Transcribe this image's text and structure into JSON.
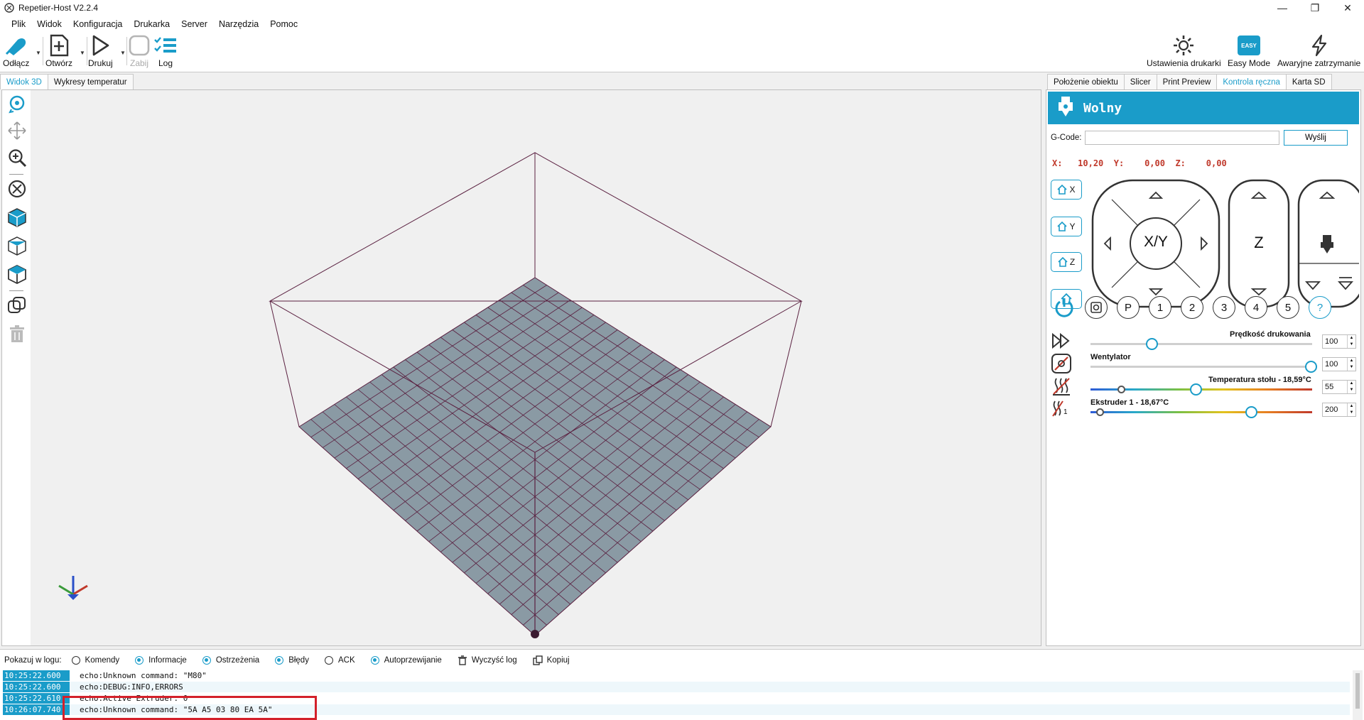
{
  "window": {
    "title": "Repetier-Host V2.2.4"
  },
  "menu": [
    "Plik",
    "Widok",
    "Konfiguracja",
    "Drukarka",
    "Server",
    "Narzędzia",
    "Pomoc"
  ],
  "toolbar": {
    "disconnect": "Odłącz",
    "open": "Otwórz",
    "print": "Drukuj",
    "kill": "Zabij",
    "log": "Log",
    "printer_settings": "Ustawienia drukarki",
    "easy_mode": "Easy Mode",
    "easy_badge": "EASY",
    "emergency_stop": "Awaryjne zatrzymanie"
  },
  "left_tabs": [
    "Widok 3D",
    "Wykresy temperatur"
  ],
  "right_tabs": [
    "Położenie obiektu",
    "Slicer",
    "Print Preview",
    "Kontrola ręczna",
    "Karta SD"
  ],
  "manual_control": {
    "status": "Wolny",
    "gcode_label": "G-Code:",
    "gcode_value": "",
    "send_label": "Wyślij",
    "coords": {
      "x_label": "X:",
      "x": "10,20",
      "y_label": "Y:",
      "y": "0,00",
      "z_label": "Z:",
      "z": "0,00"
    },
    "home_axes": [
      "X",
      "Y",
      "Z"
    ],
    "jog": {
      "xy": "X/Y",
      "z": "Z"
    },
    "presets": [
      "P",
      "1",
      "2",
      "3",
      "4",
      "5",
      "?"
    ],
    "sliders": {
      "speed": {
        "label": "Prędkość drukowania",
        "value": "100"
      },
      "fan": {
        "label": "Wentylator",
        "value": "100"
      },
      "bed": {
        "label": "Temperatura stołu - 18,59°C",
        "value": "55"
      },
      "extruder": {
        "label": "Ekstruder 1 - 18,67°C",
        "value": "200",
        "icon_index": "1"
      }
    }
  },
  "log_filter": {
    "label": "Pokazuj w logu:",
    "items": [
      {
        "label": "Komendy",
        "checked": false
      },
      {
        "label": "Informacje",
        "checked": true
      },
      {
        "label": "Ostrzeżenia",
        "checked": true
      },
      {
        "label": "Błędy",
        "checked": true
      },
      {
        "label": "ACK",
        "checked": false
      },
      {
        "label": "Autoprzewijanie",
        "checked": true
      }
    ],
    "clear": "Wyczyść log",
    "copy": "Kopiuj"
  },
  "log": [
    {
      "time": "10:25:22.600",
      "msg": "echo:Unknown command: \"M80\""
    },
    {
      "time": "10:25:22.600",
      "msg": "echo:DEBUG:INFO,ERRORS"
    },
    {
      "time": "10:25:22.610",
      "msg": "echo:Active Extruder: 0"
    },
    {
      "time": "10:26:07.740",
      "msg": "echo:Unknown command: \"5A A5 03 80 EA 5A\""
    }
  ],
  "colors": {
    "accent": "#1a9cc9",
    "highlight": "#d3202a",
    "bed": "#8a9aa4",
    "frame": "#5a2040"
  }
}
